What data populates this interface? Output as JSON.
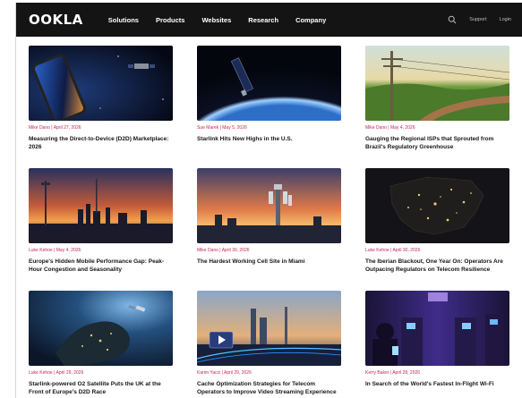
{
  "nav": {
    "logo": "OOKLA",
    "menu": [
      "Solutions",
      "Products",
      "Websites",
      "Research",
      "Company"
    ],
    "support": "Support",
    "login": "Login"
  },
  "articles": [
    {
      "meta": "Mike Dano | April 27, 2026",
      "title": "Measuring the Direct-to-Device (D2D) Marketplace: 2026"
    },
    {
      "meta": "Sue Marek | May 5, 2026",
      "title": "Starlink Hits New Highs in the U.S."
    },
    {
      "meta": "Mike Dano | May 4, 2026",
      "title": "Gauging the Regional ISPs that Sprouted from Brazil's Regulatory Greenhouse"
    },
    {
      "meta": "Luke Kehoe | May 4, 2026",
      "title": "Europe's Hidden Mobile Performance Gap: Peak-Hour Congestion and Seasonality"
    },
    {
      "meta": "Mike Dano | April 30, 2026",
      "title": "The Hardest Working Cell Site in Miami"
    },
    {
      "meta": "Luke Kehoe | April 30, 2026",
      "title": "The Iberian Blackout, One Year On: Operators Are Outpacing Regulators on Telecom Resilience"
    },
    {
      "meta": "Luke Kehoe | April 29, 2026",
      "title": "Starlink-powered O2 Satellite Puts the UK at the Front of Europe's D2D Race"
    },
    {
      "meta": "Karim Yacci | April 29, 2026",
      "title": "Cache Optimization Strategies for Telecom Operators to Improve Video Streaming Experience"
    },
    {
      "meta": "Kerry Baker | April 28, 2026",
      "title": "In Search of the World's Fastest In-Flight Wi-Fi"
    }
  ]
}
